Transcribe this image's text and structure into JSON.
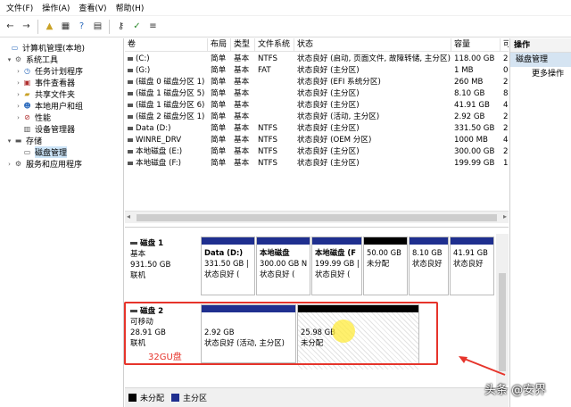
{
  "menu": [
    "文件(F)",
    "操作(A)",
    "查看(V)",
    "帮助(H)"
  ],
  "toolbar": [
    "back-icon",
    "forward-icon",
    "folder-up-icon",
    "properties-icon",
    "help-icon",
    "grid-icon",
    "key-icon",
    "checkmark-icon",
    "list-icon"
  ],
  "tree": [
    {
      "label": "计算机管理(本地)",
      "icon": "computer-icon",
      "level": 0,
      "expander": "",
      "selected": false
    },
    {
      "label": "系统工具",
      "icon": "tools-icon",
      "level": 1,
      "expander": "▾",
      "selected": false
    },
    {
      "label": "任务计划程序",
      "icon": "clock-icon",
      "level": 2,
      "expander": "›",
      "selected": false
    },
    {
      "label": "事件查看器",
      "icon": "event-icon",
      "level": 2,
      "expander": "›",
      "selected": false
    },
    {
      "label": "共享文件夹",
      "icon": "share-icon",
      "level": 2,
      "expander": "›",
      "selected": false
    },
    {
      "label": "本地用户和组",
      "icon": "users-icon",
      "level": 2,
      "expander": "›",
      "selected": false
    },
    {
      "label": "性能",
      "icon": "perf-icon",
      "level": 2,
      "expander": "›",
      "selected": false
    },
    {
      "label": "设备管理器",
      "icon": "device-icon",
      "level": 2,
      "expander": "",
      "selected": false
    },
    {
      "label": "存储",
      "icon": "storage-icon",
      "level": 1,
      "expander": "▾",
      "selected": false
    },
    {
      "label": "磁盘管理",
      "icon": "disk-icon",
      "level": 2,
      "expander": "",
      "selected": true
    },
    {
      "label": "服务和应用程序",
      "icon": "services-icon",
      "level": 1,
      "expander": "›",
      "selected": false
    }
  ],
  "volumes": {
    "headers": [
      "卷",
      "布局",
      "类型",
      "文件系统",
      "状态",
      "容量",
      "可"
    ],
    "rows": [
      [
        "(C:)",
        "简单",
        "基本",
        "NTFS",
        "状态良好 (启动, 页面文件, 故障转储, 主分区)",
        "118.00 GB",
        "2"
      ],
      [
        "(G:)",
        "简单",
        "基本",
        "FAT",
        "状态良好 (主分区)",
        "1 MB",
        "0"
      ],
      [
        "(磁盘 0 磁盘分区 1)",
        "简单",
        "基本",
        "",
        "状态良好 (EFI 系统分区)",
        "260 MB",
        "2"
      ],
      [
        "(磁盘 1 磁盘分区 5)",
        "简单",
        "基本",
        "",
        "状态良好 (主分区)",
        "8.10 GB",
        "8"
      ],
      [
        "(磁盘 1 磁盘分区 6)",
        "简单",
        "基本",
        "",
        "状态良好 (主分区)",
        "41.91 GB",
        "4"
      ],
      [
        "(磁盘 2 磁盘分区 1)",
        "简单",
        "基本",
        "",
        "状态良好 (活动, 主分区)",
        "2.92 GB",
        "2"
      ],
      [
        "Data (D:)",
        "简单",
        "基本",
        "NTFS",
        "状态良好 (主分区)",
        "331.50 GB",
        "2"
      ],
      [
        "WINRE_DRV",
        "简单",
        "基本",
        "NTFS",
        "状态良好 (OEM 分区)",
        "1000 MB",
        "4"
      ],
      [
        "本地磁盘 (E:)",
        "简单",
        "基本",
        "NTFS",
        "状态良好 (主分区)",
        "300.00 GB",
        "2"
      ],
      [
        "本地磁盘 (F:)",
        "简单",
        "基本",
        "NTFS",
        "状态良好 (主分区)",
        "199.99 GB",
        "1"
      ]
    ]
  },
  "disks": [
    {
      "title": "磁盘 1",
      "type": "基本",
      "size": "931.50 GB",
      "status": "联机",
      "partitions": [
        {
          "name": "Data (D:)",
          "size": "331.50 GB |",
          "status": "状态良好 (",
          "kind": "primary"
        },
        {
          "name": "本地磁盘",
          "size": "300.00 GB N",
          "status": "状态良好 (",
          "kind": "primary"
        },
        {
          "name": "本地磁盘 (F",
          "size": "199.99 GB |",
          "status": "状态良好 (",
          "kind": "primary"
        },
        {
          "name": "",
          "size": "50.00 GB",
          "status": "未分配",
          "kind": "unalloc"
        },
        {
          "name": "",
          "size": "8.10 GB",
          "status": "状态良好",
          "kind": "primary"
        },
        {
          "name": "",
          "size": "41.91 GB",
          "status": "状态良好",
          "kind": "primary"
        }
      ]
    },
    {
      "title": "磁盘 2",
      "type": "可移动",
      "size": "28.91 GB",
      "status": "联机",
      "partitions": [
        {
          "name": "",
          "size": "2.92 GB",
          "status": "状态良好 (活动, 主分区)",
          "kind": "primary"
        },
        {
          "name": "",
          "size": "25.98 GB",
          "status": "未分配",
          "kind": "unalloc"
        }
      ]
    }
  ],
  "annotation": "32GU盘",
  "legend": [
    {
      "label": "未分配",
      "color": "#000000"
    },
    {
      "label": "主分区",
      "color": "#1f2f8f"
    }
  ],
  "actions": {
    "header": "操作",
    "section": "磁盘管理",
    "more": "更多操作"
  },
  "watermark": "头条 @安界",
  "colors": {
    "primary": "#1f2f8f",
    "unallocated": "#000000",
    "highlight": "#e6342b"
  }
}
